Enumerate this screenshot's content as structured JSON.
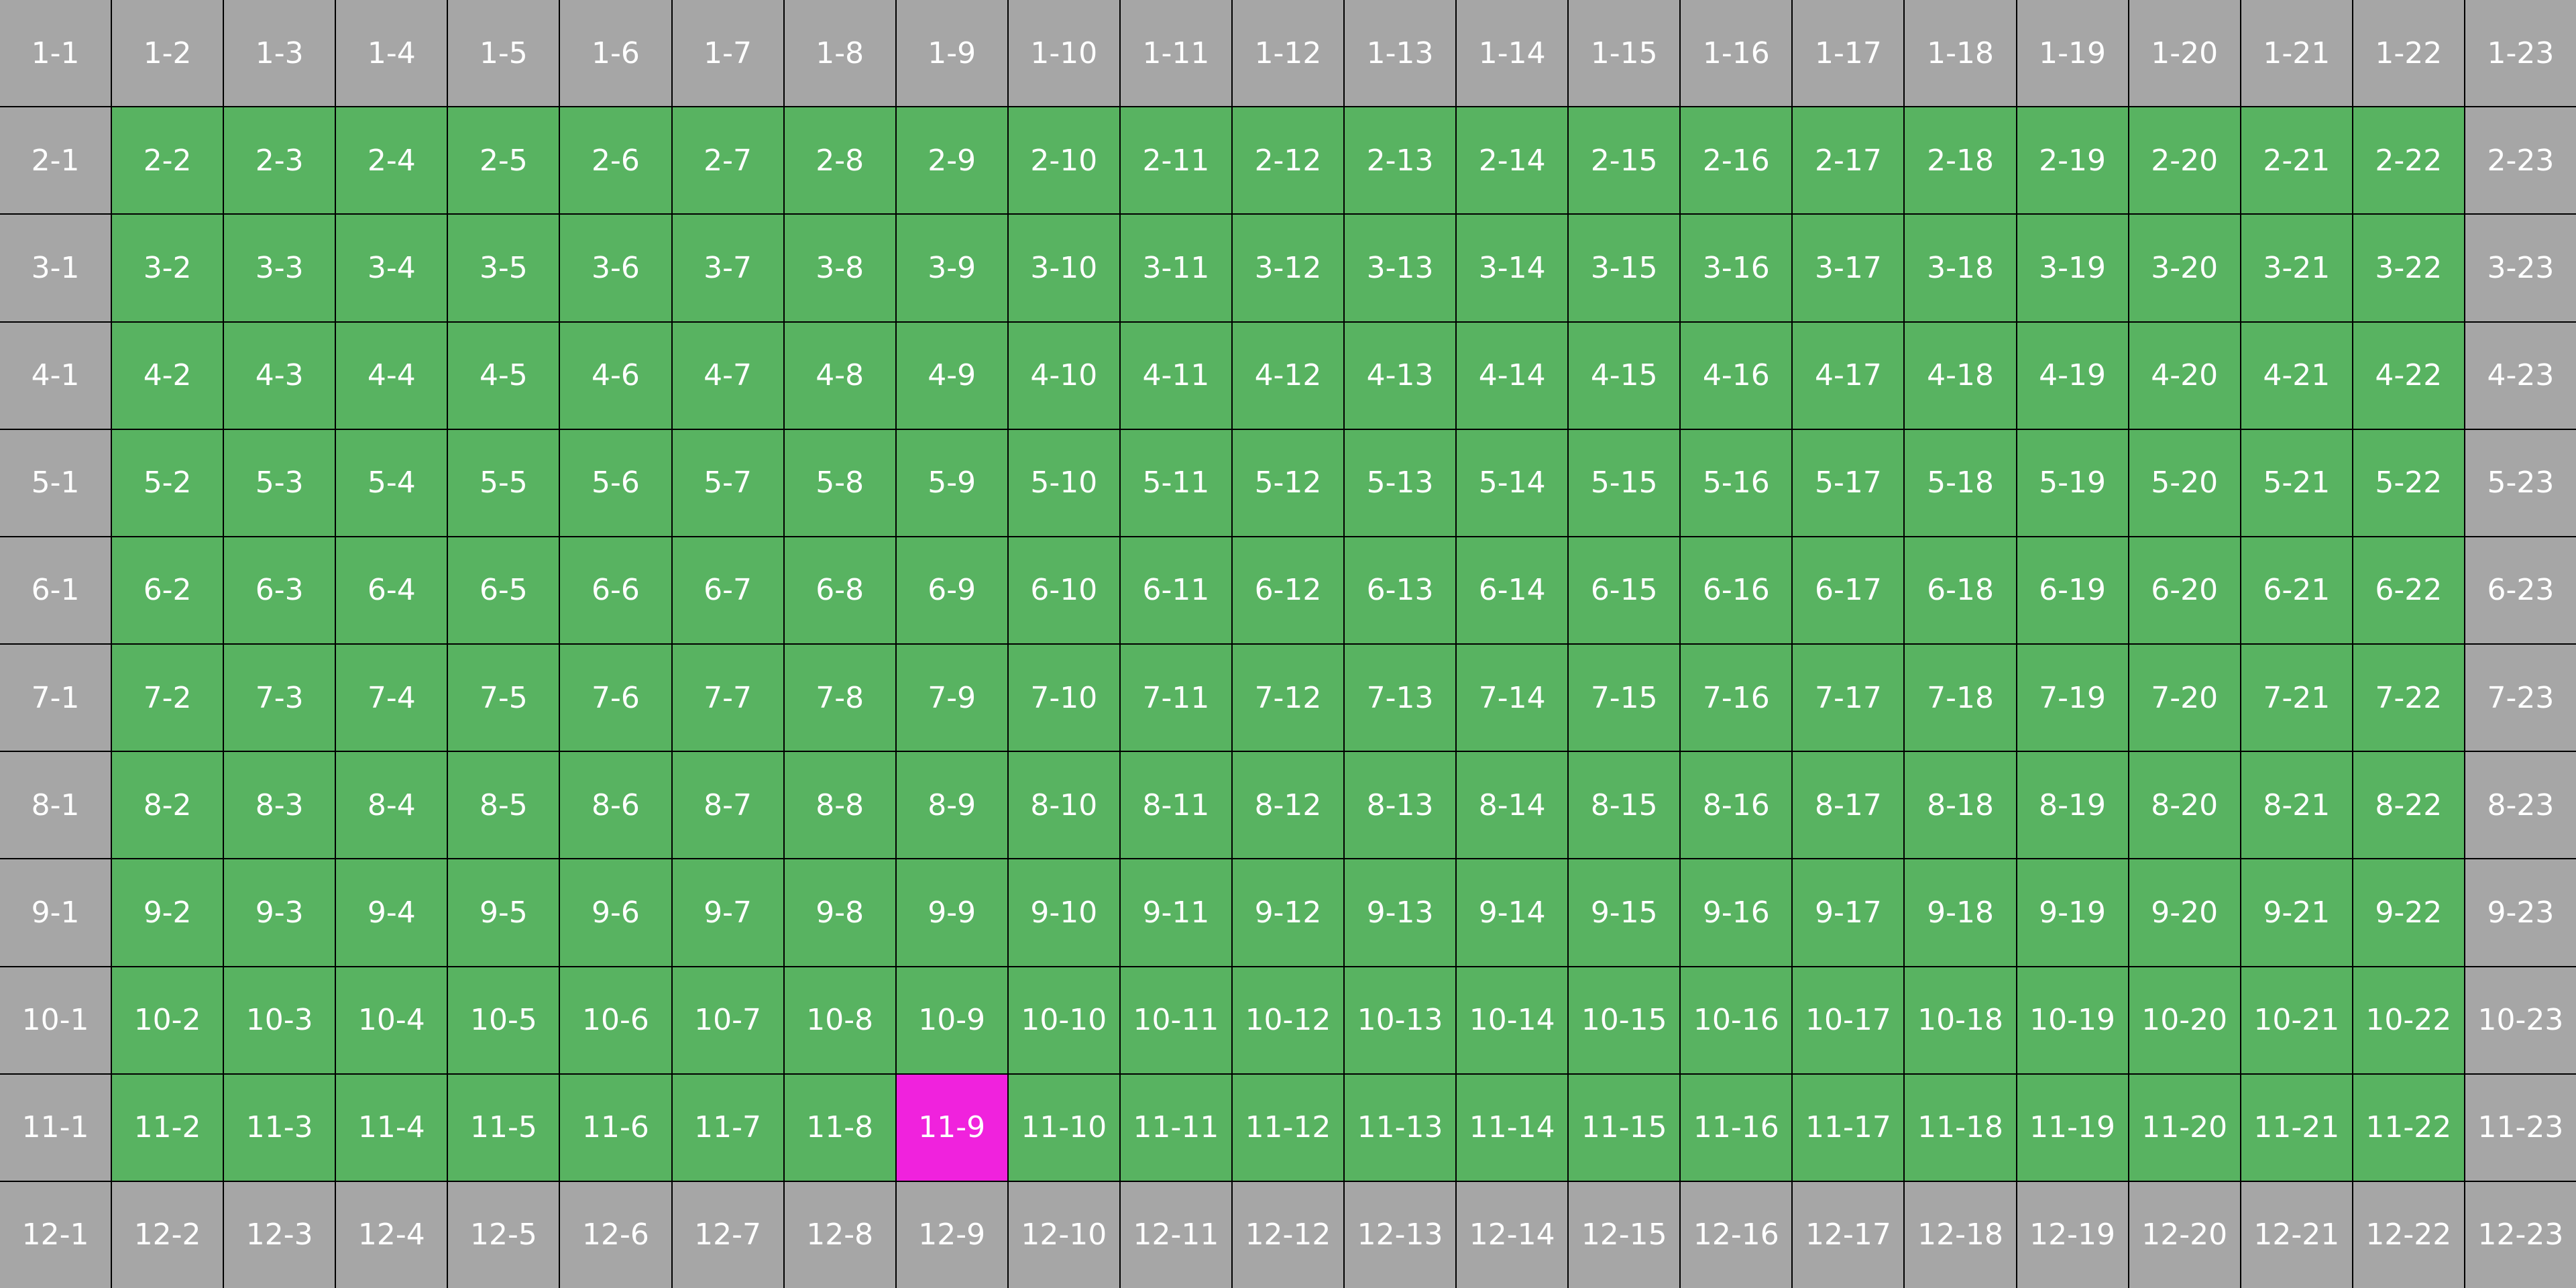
{
  "grid": {
    "rows": 12,
    "cols": 23,
    "colors": {
      "border_cell": "#a6a6a6",
      "inner_cell": "#58b361",
      "highlight_cell": "#f022dd",
      "text": "#ffffff",
      "gridline": "#000000"
    },
    "highlight": {
      "row": 11,
      "col": 9
    },
    "labels": [
      [
        "1-1",
        "1-2",
        "1-3",
        "1-4",
        "1-5",
        "1-6",
        "1-7",
        "1-8",
        "1-9",
        "1-10",
        "1-11",
        "1-12",
        "1-13",
        "1-14",
        "1-15",
        "1-16",
        "1-17",
        "1-18",
        "1-19",
        "1-20",
        "1-21",
        "1-22",
        "1-23"
      ],
      [
        "2-1",
        "2-2",
        "2-3",
        "2-4",
        "2-5",
        "2-6",
        "2-7",
        "2-8",
        "2-9",
        "2-10",
        "2-11",
        "2-12",
        "2-13",
        "2-14",
        "2-15",
        "2-16",
        "2-17",
        "2-18",
        "2-19",
        "2-20",
        "2-21",
        "2-22",
        "2-23"
      ],
      [
        "3-1",
        "3-2",
        "3-3",
        "3-4",
        "3-5",
        "3-6",
        "3-7",
        "3-8",
        "3-9",
        "3-10",
        "3-11",
        "3-12",
        "3-13",
        "3-14",
        "3-15",
        "3-16",
        "3-17",
        "3-18",
        "3-19",
        "3-20",
        "3-21",
        "3-22",
        "3-23"
      ],
      [
        "4-1",
        "4-2",
        "4-3",
        "4-4",
        "4-5",
        "4-6",
        "4-7",
        "4-8",
        "4-9",
        "4-10",
        "4-11",
        "4-12",
        "4-13",
        "4-14",
        "4-15",
        "4-16",
        "4-17",
        "4-18",
        "4-19",
        "4-20",
        "4-21",
        "4-22",
        "4-23"
      ],
      [
        "5-1",
        "5-2",
        "5-3",
        "5-4",
        "5-5",
        "5-6",
        "5-7",
        "5-8",
        "5-9",
        "5-10",
        "5-11",
        "5-12",
        "5-13",
        "5-14",
        "5-15",
        "5-16",
        "5-17",
        "5-18",
        "5-19",
        "5-20",
        "5-21",
        "5-22",
        "5-23"
      ],
      [
        "6-1",
        "6-2",
        "6-3",
        "6-4",
        "6-5",
        "6-6",
        "6-7",
        "6-8",
        "6-9",
        "6-10",
        "6-11",
        "6-12",
        "6-13",
        "6-14",
        "6-15",
        "6-16",
        "6-17",
        "6-18",
        "6-19",
        "6-20",
        "6-21",
        "6-22",
        "6-23"
      ],
      [
        "7-1",
        "7-2",
        "7-3",
        "7-4",
        "7-5",
        "7-6",
        "7-7",
        "7-8",
        "7-9",
        "7-10",
        "7-11",
        "7-12",
        "7-13",
        "7-14",
        "7-15",
        "7-16",
        "7-17",
        "7-18",
        "7-19",
        "7-20",
        "7-21",
        "7-22",
        "7-23"
      ],
      [
        "8-1",
        "8-2",
        "8-3",
        "8-4",
        "8-5",
        "8-6",
        "8-7",
        "8-8",
        "8-9",
        "8-10",
        "8-11",
        "8-12",
        "8-13",
        "8-14",
        "8-15",
        "8-16",
        "8-17",
        "8-18",
        "8-19",
        "8-20",
        "8-21",
        "8-22",
        "8-23"
      ],
      [
        "9-1",
        "9-2",
        "9-3",
        "9-4",
        "9-5",
        "9-6",
        "9-7",
        "9-8",
        "9-9",
        "9-10",
        "9-11",
        "9-12",
        "9-13",
        "9-14",
        "9-15",
        "9-16",
        "9-17",
        "9-18",
        "9-19",
        "9-20",
        "9-21",
        "9-22",
        "9-23"
      ],
      [
        "10-1",
        "10-2",
        "10-3",
        "10-4",
        "10-5",
        "10-6",
        "10-7",
        "10-8",
        "10-9",
        "10-10",
        "10-11",
        "10-12",
        "10-13",
        "10-14",
        "10-15",
        "10-16",
        "10-17",
        "10-18",
        "10-19",
        "10-20",
        "10-21",
        "10-22",
        "10-23"
      ],
      [
        "11-1",
        "11-2",
        "11-3",
        "11-4",
        "11-5",
        "11-6",
        "11-7",
        "11-8",
        "11-9",
        "11-10",
        "11-11",
        "11-12",
        "11-13",
        "11-14",
        "11-15",
        "11-16",
        "11-17",
        "11-18",
        "11-19",
        "11-20",
        "11-21",
        "11-22",
        "11-23"
      ],
      [
        "12-1",
        "12-2",
        "12-3",
        "12-4",
        "12-5",
        "12-6",
        "12-7",
        "12-8",
        "12-9",
        "12-10",
        "12-11",
        "12-12",
        "12-13",
        "12-14",
        "12-15",
        "12-16",
        "12-17",
        "12-18",
        "12-19",
        "12-20",
        "12-21",
        "12-22",
        "12-23"
      ]
    ]
  }
}
